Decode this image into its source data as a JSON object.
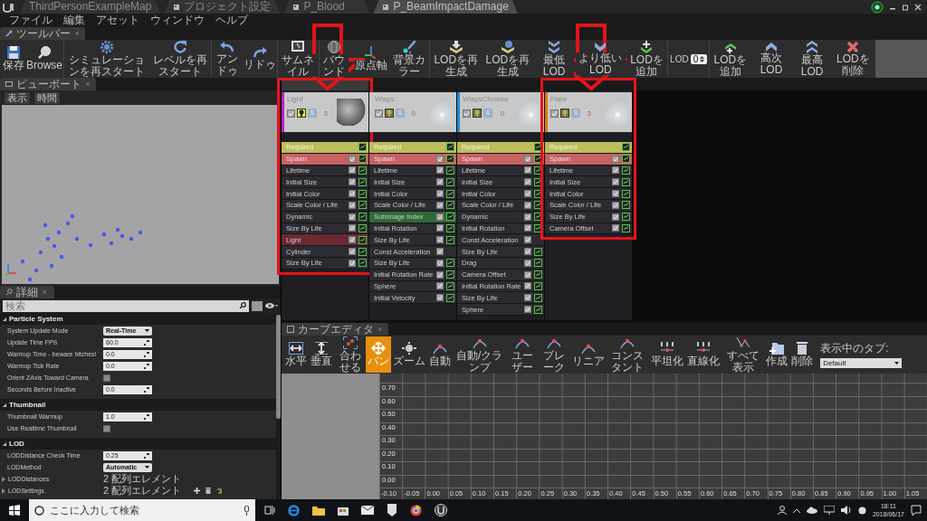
{
  "tabs": [
    {
      "label": "ThirdPersonExampleMap",
      "selected": false
    },
    {
      "label": "プロジェクト設定",
      "selected": false
    },
    {
      "label": "P_Blood",
      "selected": false
    },
    {
      "label": "P_BeamImpactDamage",
      "selected": true
    }
  ],
  "menu": [
    "ファイル",
    "編集",
    "アセット",
    "ウィンドウ",
    "ヘルプ"
  ],
  "toolbar": {
    "tab": "ツールバー",
    "buttons": [
      {
        "kind": "button",
        "label": "保存"
      },
      {
        "kind": "button",
        "label": "Browse"
      },
      {
        "kind": "button",
        "label": "シミュレーションを再スタート"
      },
      {
        "kind": "button",
        "label": "レベルを再スタート"
      },
      {
        "kind": "button",
        "label": "アンドゥ"
      },
      {
        "kind": "button",
        "label": "リドゥ"
      },
      {
        "kind": "button",
        "label": "サムネイル"
      },
      {
        "kind": "button",
        "label": "バウンド"
      },
      {
        "kind": "button",
        "label": "原点軸"
      },
      {
        "kind": "button",
        "label": "背景カラー"
      },
      {
        "kind": "button",
        "label": "LODを再生成"
      },
      {
        "kind": "button",
        "label": "LODを再生成"
      },
      {
        "kind": "button",
        "label": "最低 LOD"
      },
      {
        "kind": "button",
        "label": "より低い LOD"
      },
      {
        "kind": "button",
        "label": "LODを追加"
      },
      {
        "kind": "lod",
        "label": "LOD",
        "value": "0"
      },
      {
        "kind": "button",
        "label": "LODを追加"
      },
      {
        "kind": "button",
        "label": "高次LOD"
      },
      {
        "kind": "button",
        "label": "最高 LOD"
      },
      {
        "kind": "button",
        "label": "LODを削除"
      }
    ]
  },
  "viewport": {
    "tab": "ビューポート",
    "buttons": [
      "表示",
      "時間"
    ]
  },
  "details": {
    "tab": "詳細",
    "search_placeholder": "検索",
    "sections": [
      {
        "title": "Particle System",
        "expanded": true,
        "properties": [
          {
            "label": "System Update Mode",
            "kind": "dropdown",
            "value": "Real-Time"
          },
          {
            "label": "Update Time FPS",
            "kind": "number",
            "value": "60.0"
          },
          {
            "label": "Warmup Time - beware hitches!",
            "kind": "number",
            "value": "0.0"
          },
          {
            "label": "Warmup Tick Rate",
            "kind": "number",
            "value": "0.0"
          },
          {
            "label": "Orient ZAxis Toward Camera",
            "kind": "checkbox",
            "checked": false
          },
          {
            "label": "Seconds Before Inactive",
            "kind": "number",
            "value": "0.0"
          }
        ]
      },
      {
        "title": "Thumbnail",
        "expanded": true,
        "properties": [
          {
            "label": "Thumbnail Warmup",
            "kind": "number",
            "value": "1.0"
          },
          {
            "label": "Use Realtime Thumbnail",
            "kind": "checkbox",
            "checked": false
          }
        ]
      },
      {
        "title": "LOD",
        "expanded": true,
        "properties": [
          {
            "label": "LODDistance Check Time",
            "kind": "number",
            "value": "0.25"
          },
          {
            "label": "LODMethod",
            "kind": "dropdown",
            "value": "Automatic"
          },
          {
            "label": "LODDistances",
            "kind": "array",
            "value": "2 配列エレメント",
            "expanded": false
          },
          {
            "label": "LODSettings",
            "kind": "array_edit",
            "value": "2 配列エレメント",
            "expanded": false
          }
        ]
      }
    ]
  },
  "emitters": [
    {
      "name": "Light",
      "color": "#c21cc2",
      "enabled": true,
      "bulb_on": true,
      "solo": "S",
      "count": "3",
      "marked": true,
      "modules": [
        {
          "name": "Required",
          "kind": "required",
          "curve": true
        },
        {
          "name": "Spawn",
          "kind": "spawn",
          "enabled": true,
          "curve": true
        },
        {
          "name": "Lifetime",
          "kind": "plain",
          "enabled": true,
          "curve": true
        },
        {
          "name": "Initial Size",
          "kind": "plain",
          "enabled": true,
          "curve": true
        },
        {
          "name": "Initial Color",
          "kind": "plain",
          "enabled": true,
          "curve": true
        },
        {
          "name": "Scale Color / Life",
          "kind": "plain",
          "enabled": true,
          "curve": true
        },
        {
          "name": "Dynamic",
          "kind": "plain",
          "enabled": true,
          "curve": true
        },
        {
          "name": "Size By Life",
          "kind": "plain",
          "enabled": true,
          "curve": true
        },
        {
          "name": "Light",
          "kind": "light",
          "enabled": true,
          "curve": true
        },
        {
          "name": "Cylinder",
          "kind": "plain",
          "enabled": true,
          "curve": true
        },
        {
          "name": "Size By Life",
          "kind": "plain",
          "enabled": true,
          "curve": true
        }
      ]
    },
    {
      "name": "Wisps",
      "enabled": true,
      "bulb_on": false,
      "solo": "S",
      "count": "0",
      "marked": false,
      "modules": [
        {
          "name": "Required",
          "kind": "required",
          "curve": true
        },
        {
          "name": "Spawn",
          "kind": "spawn",
          "enabled": true,
          "curve": true
        },
        {
          "name": "Lifetime",
          "kind": "plain",
          "enabled": true,
          "curve": true
        },
        {
          "name": "Initial Size",
          "kind": "plain",
          "enabled": true,
          "curve": true
        },
        {
          "name": "Initial Color",
          "kind": "plain",
          "enabled": true,
          "curve": true
        },
        {
          "name": "Scale Color / Life",
          "kind": "plain",
          "enabled": true,
          "curve": true
        },
        {
          "name": "SubImage Index",
          "kind": "subuv",
          "enabled": true,
          "curve": true
        },
        {
          "name": "Initial Rotation",
          "kind": "plain",
          "enabled": true,
          "curve": true
        },
        {
          "name": "Size By Life",
          "kind": "plain",
          "enabled": true,
          "curve": true
        },
        {
          "name": "Const Acceleration",
          "kind": "plain",
          "enabled": true,
          "curve": false
        },
        {
          "name": "Size By Life",
          "kind": "plain",
          "enabled": true,
          "curve": true
        },
        {
          "name": "Initial Rotation Rate",
          "kind": "plain",
          "enabled": true,
          "curve": true
        },
        {
          "name": "Sphere",
          "kind": "plain",
          "enabled": true,
          "curve": true
        },
        {
          "name": "Initial Velocity",
          "kind": "plain",
          "enabled": true,
          "curve": true
        }
      ]
    },
    {
      "name": "WispsChroma",
      "color": "#1d8fd8",
      "enabled": true,
      "bulb_on": false,
      "solo": "S",
      "count": "0",
      "marked": false,
      "modules": [
        {
          "name": "Required",
          "kind": "required",
          "curve": true
        },
        {
          "name": "Spawn",
          "kind": "spawn",
          "enabled": true,
          "curve": true
        },
        {
          "name": "Lifetime",
          "kind": "plain",
          "enabled": true,
          "curve": true
        },
        {
          "name": "Initial Size",
          "kind": "plain",
          "enabled": true,
          "curve": true
        },
        {
          "name": "Initial Color",
          "kind": "plain",
          "enabled": true,
          "curve": true
        },
        {
          "name": "Scale Color / Life",
          "kind": "plain",
          "enabled": true,
          "curve": true
        },
        {
          "name": "Dynamic",
          "kind": "plain",
          "enabled": true,
          "curve": true
        },
        {
          "name": "Initial Rotation",
          "kind": "plain",
          "enabled": true,
          "curve": true
        },
        {
          "name": "Const Acceleration",
          "kind": "plain",
          "enabled": true,
          "curve": false
        },
        {
          "name": "Size By Life",
          "kind": "plain",
          "enabled": true,
          "curve": true
        },
        {
          "name": "Drag",
          "kind": "plain",
          "enabled": true,
          "curve": true
        },
        {
          "name": "Camera Offset",
          "kind": "plain",
          "enabled": true,
          "curve": true
        },
        {
          "name": "Initial Rotation Rate",
          "kind": "plain",
          "enabled": true,
          "curve": true
        },
        {
          "name": "Size By Life",
          "kind": "plain",
          "enabled": true,
          "curve": true
        },
        {
          "name": "Sphere",
          "kind": "plain",
          "enabled": true,
          "curve": true
        }
      ]
    },
    {
      "name": "Flare",
      "color": "#de7a12",
      "enabled": true,
      "bulb_on": false,
      "solo": "S",
      "count": "3",
      "marked": true,
      "modules": [
        {
          "name": "Required",
          "kind": "required",
          "curve": true
        },
        {
          "name": "Spawn",
          "kind": "spawn",
          "enabled": true,
          "curve": true
        },
        {
          "name": "Lifetime",
          "kind": "plain",
          "enabled": true,
          "curve": true
        },
        {
          "name": "Initial Size",
          "kind": "plain",
          "enabled": true,
          "curve": true
        },
        {
          "name": "Initial Color",
          "kind": "plain",
          "enabled": true,
          "curve": true
        },
        {
          "name": "Scale Color / Life",
          "kind": "plain",
          "enabled": true,
          "curve": true
        },
        {
          "name": "Size By Life",
          "kind": "plain",
          "enabled": true,
          "curve": true
        },
        {
          "name": "Camera Offset",
          "kind": "plain",
          "enabled": true,
          "curve": true
        }
      ]
    }
  ],
  "curve_editor": {
    "tab": "カーブエディタ",
    "buttons": [
      {
        "label": "水平",
        "selected": false
      },
      {
        "label": "垂直",
        "selected": false
      },
      {
        "label": "合わせる",
        "selected": false
      },
      {
        "label": "パン",
        "selected": true
      },
      {
        "label": "ズーム",
        "selected": false
      },
      {
        "label": "自動",
        "selected": false
      },
      {
        "label": "自動/クランプ",
        "selected": false
      },
      {
        "label": "ユーザー",
        "selected": false
      },
      {
        "label": "ブレーク",
        "selected": false
      },
      {
        "label": "リニア",
        "selected": false
      },
      {
        "label": "コンスタント",
        "selected": false
      },
      {
        "label": "平坦化",
        "selected": false
      },
      {
        "label": "直線化",
        "selected": false
      },
      {
        "label": "すべて表示",
        "selected": false
      },
      {
        "label": "作成",
        "selected": false
      },
      {
        "label": "削除",
        "selected": false
      }
    ],
    "tab_label": "表示中のタブ:",
    "tab_value": "Default",
    "y_labels": [
      "0.70",
      "0.60",
      "0.50",
      "0.40",
      "0.30",
      "0.20",
      "0.10",
      "0.00"
    ],
    "x_labels": [
      "-0.10",
      "-0.05",
      "0.00",
      "0.05",
      "0.10",
      "0.15",
      "0.20",
      "0.25",
      "0.30",
      "0.35",
      "0.40",
      "0.45",
      "0.50",
      "0.55",
      "0.60",
      "0.65",
      "0.70",
      "0.75",
      "0.80",
      "0.85",
      "0.90",
      "0.95",
      "1.00",
      "1.05"
    ]
  },
  "taskbar": {
    "search_placeholder": "ここに入力して検索",
    "time": "18:11",
    "date": "2018/06/17"
  }
}
